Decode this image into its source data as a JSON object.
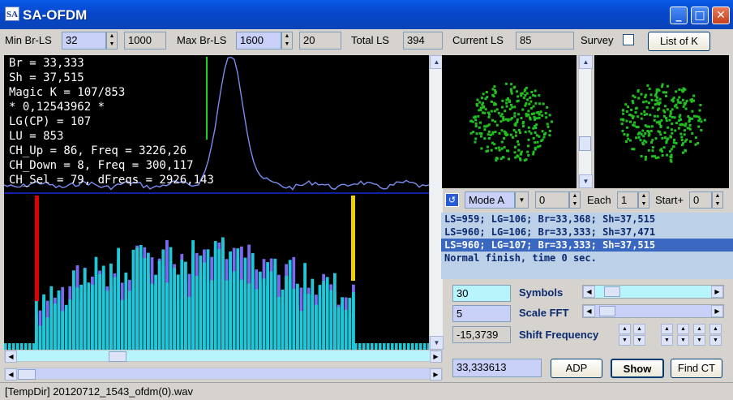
{
  "window": {
    "title": "SA-OFDM",
    "icon_text": "SA",
    "min_glyph": "_",
    "max_glyph": "□",
    "close_glyph": "✕"
  },
  "toolbar": {
    "min_br_ls_label": "Min Br-LS",
    "min_br_ls_value": "32",
    "min_br_ls_aux": "1000",
    "max_br_ls_label": "Max Br-LS",
    "max_br_ls_value": "1600",
    "max_br_ls_aux": "20",
    "total_ls_label": "Total LS",
    "total_ls_value": "394",
    "current_ls_label": "Current LS",
    "current_ls_value": "85",
    "survey_label": "Survey",
    "list_of_k_label": "List of K"
  },
  "info": [
    "Br = 33,333",
    "Sh = 37,515",
    "Magic K = 107/853",
    "* 0,12543962 *",
    "LG(CP) = 107",
    "LU = 853",
    "CH_Up = 86, Freq = 3226,26",
    "CH_Down = 8, Freq = 300,117",
    "CH_Sel = 79, dFreqs = 2926,143"
  ],
  "mode_row": {
    "mode_value": "Mode A",
    "mode_num": "0",
    "each_label": "Each",
    "each_value": "1",
    "start_label": "Start+",
    "start_value": "0"
  },
  "log": [
    "LS=959; LG=106; Br=33,368; Sh=37,515",
    "LS=960; LG=106; Br=33,333; Sh=37,471",
    "LS=960; LG=107; Br=33,333; Sh=37,515",
    "Normal finish, time 0 sec."
  ],
  "params": {
    "symbols_value": "30",
    "symbols_label": "Symbols",
    "scale_fft_value": "5",
    "scale_fft_label": "Scale FFT",
    "shift_value": "-15,3739",
    "shift_label": "Shift Frequency",
    "result_value": "33,333613"
  },
  "buttons": {
    "adp": "ADP",
    "show": "Show",
    "find_ct": "Find CT"
  },
  "status": {
    "text": "[TempDir] 20120712_1543_ofdm(0).wav"
  },
  "colors": {
    "plot_bg": "#000000",
    "bar_cyan": "#1ec8d8",
    "bar_purple": "#7a6af0",
    "curve": "#7a8cf0",
    "points": "#20c020",
    "marker_red": "#e00000",
    "marker_yellow": "#f0d000",
    "marker_green": "#20d020"
  }
}
